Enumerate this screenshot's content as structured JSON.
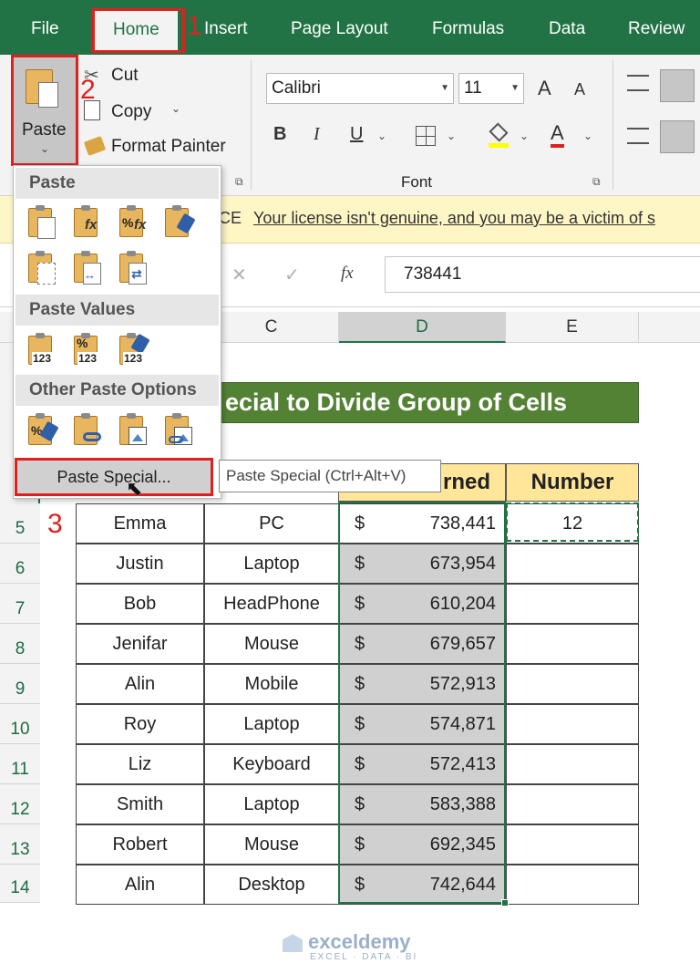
{
  "menu": {
    "tabs": [
      "File",
      "Home",
      "Insert",
      "Page Layout",
      "Formulas",
      "Data",
      "Review"
    ],
    "active": "Home"
  },
  "ribbon": {
    "paste": "Paste",
    "cut": "Cut",
    "copy": "Copy",
    "format_painter": "Format Painter",
    "font_name": "Calibri",
    "font_size": "11",
    "font_group_label": "Font",
    "bold": "B",
    "italic": "I",
    "underline": "U",
    "font_color": "A",
    "grow_font": "A",
    "shrink_font": "A"
  },
  "license_bar": {
    "prefix": "CE",
    "message": "Your license isn't genuine, and you may be a victim of s"
  },
  "formula_bar": {
    "fx": "fx",
    "cancel": "✕",
    "enter": "✓",
    "value": "738441"
  },
  "columns": [
    "C",
    "D",
    "E"
  ],
  "rows": [
    "5",
    "6",
    "7",
    "8",
    "9",
    "10",
    "11",
    "12",
    "13",
    "14"
  ],
  "sheet": {
    "title": "ecial to Divide Group of Cells",
    "header_earned": "rned",
    "header_number": "Number",
    "data": [
      {
        "name": "Emma",
        "product": "PC",
        "currency": "$",
        "amount": "738,441",
        "number": "12"
      },
      {
        "name": "Justin",
        "product": "Laptop",
        "currency": "$",
        "amount": "673,954",
        "number": ""
      },
      {
        "name": "Bob",
        "product": "HeadPhone",
        "currency": "$",
        "amount": "610,204",
        "number": ""
      },
      {
        "name": "Jenifar",
        "product": "Mouse",
        "currency": "$",
        "amount": "679,657",
        "number": ""
      },
      {
        "name": "Alin",
        "product": "Mobile",
        "currency": "$",
        "amount": "572,913",
        "number": ""
      },
      {
        "name": "Roy",
        "product": "Laptop",
        "currency": "$",
        "amount": "574,871",
        "number": ""
      },
      {
        "name": "Liz",
        "product": "Keyboard",
        "currency": "$",
        "amount": "572,413",
        "number": ""
      },
      {
        "name": "Smith",
        "product": "Laptop",
        "currency": "$",
        "amount": "583,388",
        "number": ""
      },
      {
        "name": "Robert",
        "product": "Mouse",
        "currency": "$",
        "amount": "692,345",
        "number": ""
      },
      {
        "name": "Alin",
        "product": "Desktop",
        "currency": "$",
        "amount": "742,644",
        "number": ""
      }
    ]
  },
  "dropdown": {
    "section_paste": "Paste",
    "section_values": "Paste Values",
    "section_other": "Other Paste Options",
    "paste_special": "Paste Special...",
    "tooltip": "Paste Special (Ctrl+Alt+V)",
    "values_label": "123",
    "formula_label": "fx",
    "percent_label": "%"
  },
  "annotations": {
    "step1": "1",
    "step2": "2",
    "step3": "3"
  },
  "watermark": {
    "brand": "exceldemy",
    "tagline": "EXCEL · DATA · BI"
  },
  "colors": {
    "excel_green": "#217346",
    "title_green": "#548235",
    "header_yellow": "#ffe699",
    "highlight_red": "#e0201e",
    "license_yellow": "#fff6c6"
  }
}
